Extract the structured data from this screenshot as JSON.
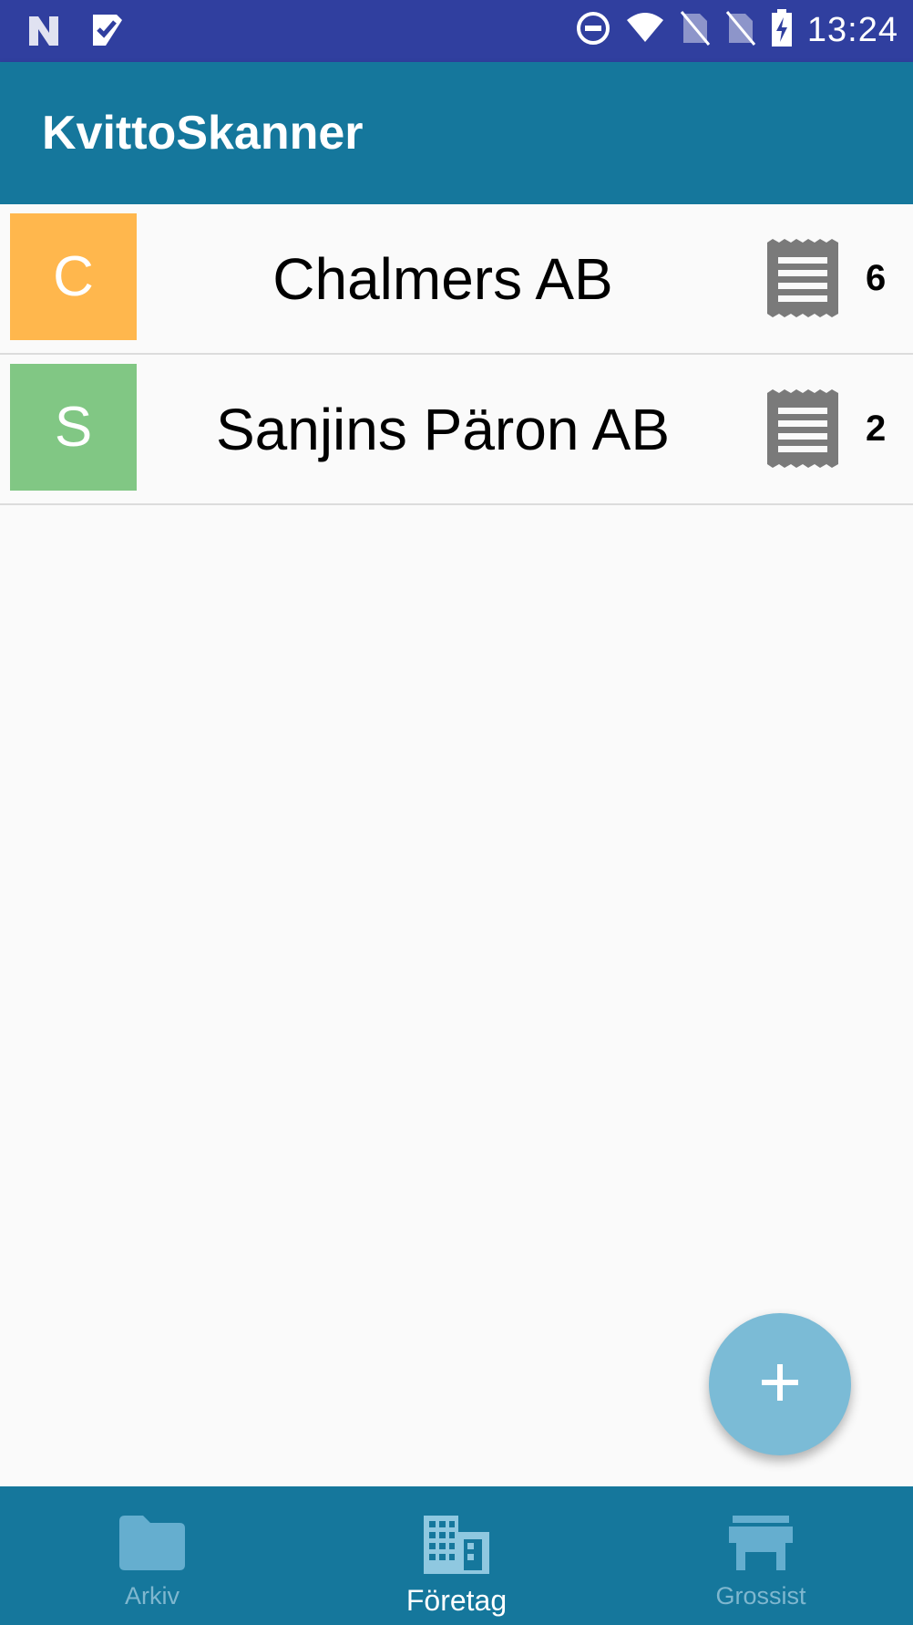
{
  "status_bar": {
    "time": "13:24",
    "icons": [
      "n-notification-icon",
      "check-notification-icon",
      "do-not-disturb-icon",
      "wifi-icon",
      "no-sim-icon",
      "no-sim-icon",
      "battery-charging-icon"
    ]
  },
  "app_bar": {
    "title": "KvittoSkanner"
  },
  "companies": [
    {
      "initial": "C",
      "name": "Chalmers AB",
      "count": "6",
      "color": "#ffb74d",
      "icon": "receipt-icon"
    },
    {
      "initial": "S",
      "name": "Sanjins Päron AB",
      "count": "2",
      "color": "#81c784",
      "icon": "receipt-icon"
    }
  ],
  "fab": {
    "icon": "plus-icon"
  },
  "bottom_nav": [
    {
      "label": "Arkiv",
      "icon": "folder-icon",
      "active": false
    },
    {
      "label": "Företag",
      "icon": "business-icon",
      "active": true
    },
    {
      "label": "Grossist",
      "icon": "store-icon",
      "active": false
    }
  ],
  "colors": {
    "status_bar": "#303f9f",
    "primary": "#15779c",
    "fab": "#7bbbd6",
    "background": "#fafafa"
  }
}
